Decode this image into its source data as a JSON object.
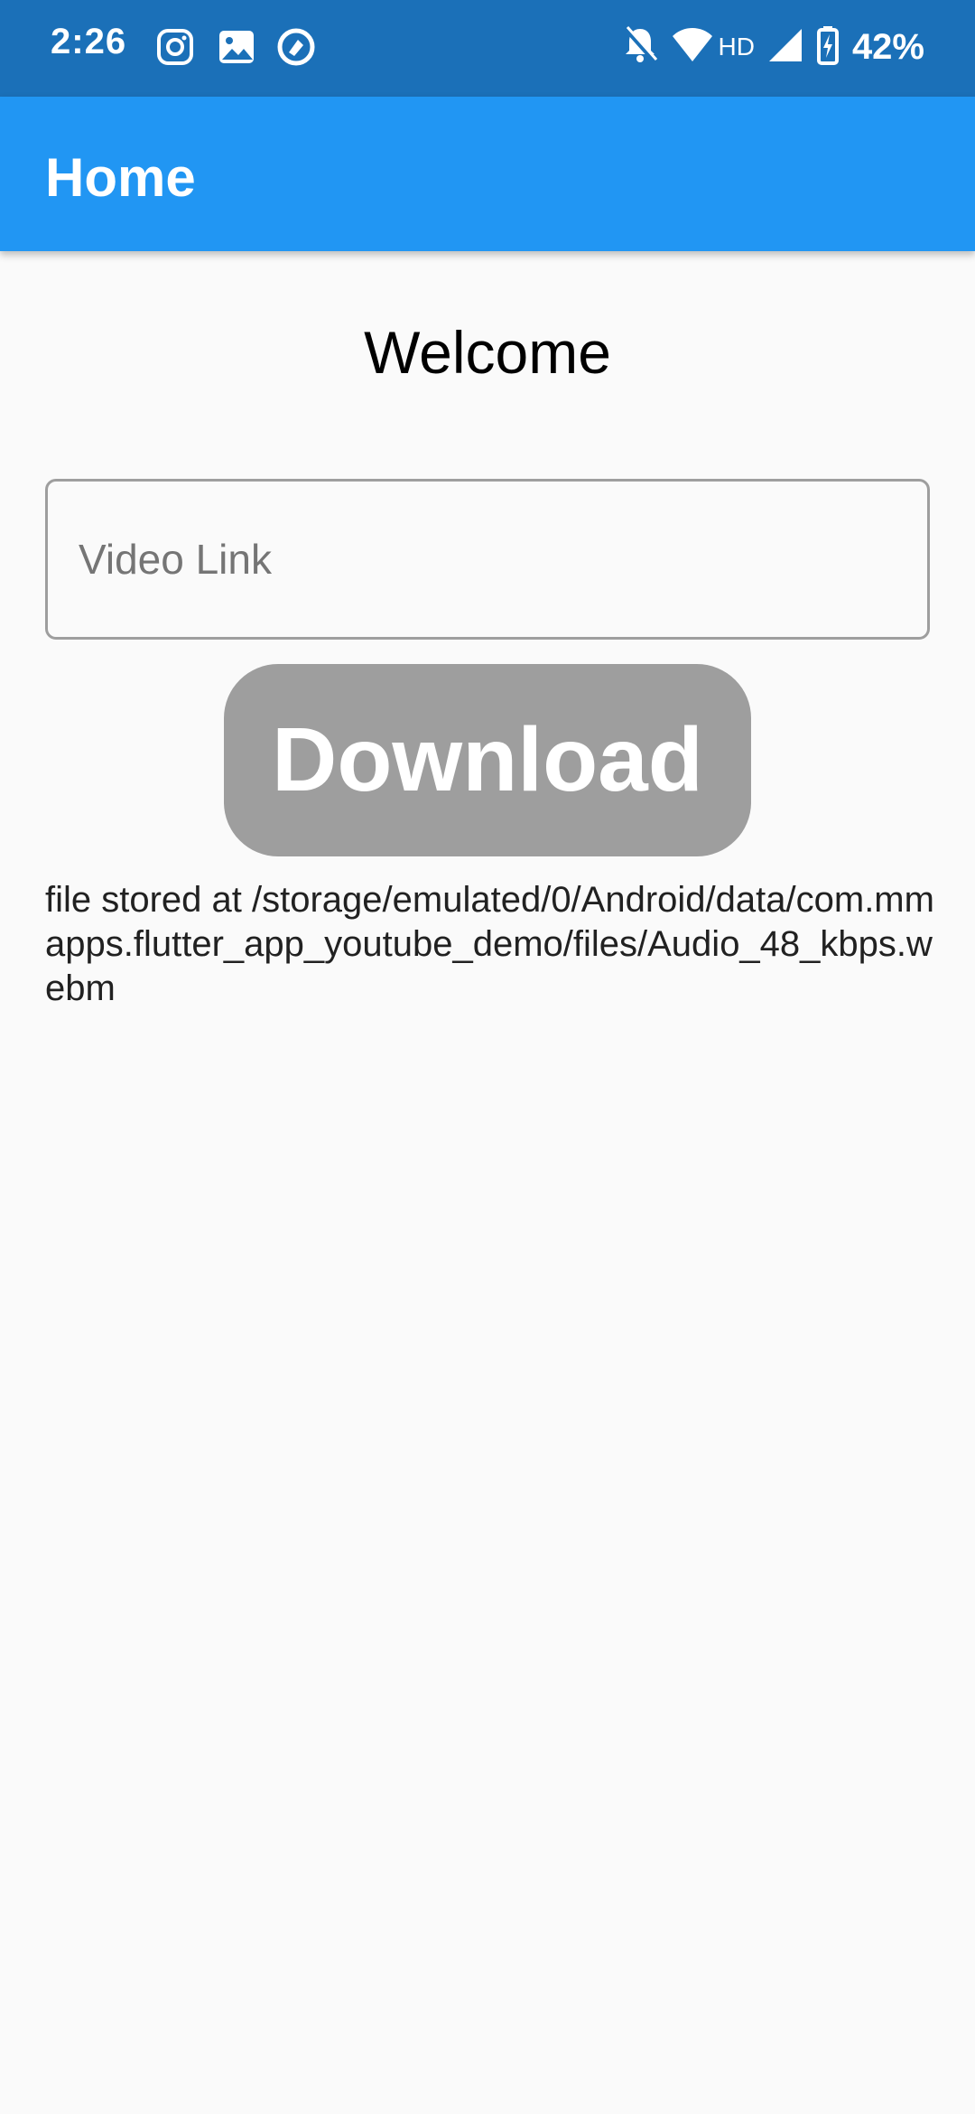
{
  "status_bar": {
    "time": "2:26",
    "battery": "42%",
    "network": "HD",
    "left_icons": [
      "instagram-icon",
      "gallery-icon",
      "app-icon"
    ],
    "right_icons": [
      "bell-off-icon",
      "wifi-icon",
      "signal-icon",
      "battery-charging-icon"
    ],
    "color": "#1b70b8"
  },
  "app_bar": {
    "title": "Home",
    "color": "#2196f3"
  },
  "main": {
    "welcome": "Welcome",
    "video_input": {
      "placeholder": "Video Link",
      "value": ""
    },
    "download_button": {
      "label": "Download",
      "color": "#9e9e9e"
    },
    "file_message": "file stored at /storage/emulated/0/Android/data/com.mmapps.flutter_app_youtube_demo/files/Audio_48_kbps.webm"
  }
}
